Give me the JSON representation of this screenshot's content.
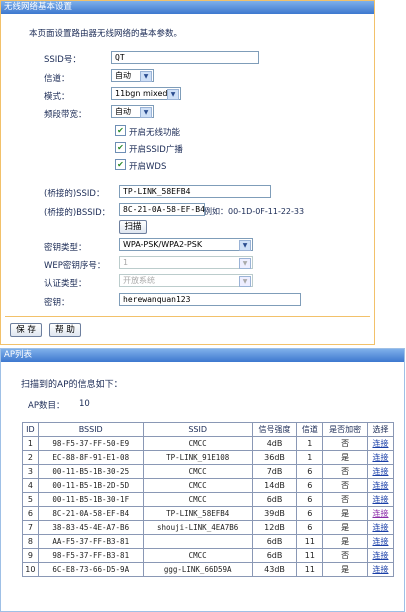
{
  "settings": {
    "title": "无线网络基本设置",
    "intro": "本页面设置路由器无线网络的基本参数。",
    "ssid_label": "SSID号：",
    "ssid_value": "QT",
    "channel_label": "信道：",
    "channel_value": "自动",
    "mode_label": "模式：",
    "mode_value": "11bgn mixed",
    "bandwidth_label": "频段带宽：",
    "bandwidth_value": "自动",
    "enable_wireless": "开启无线功能",
    "enable_ssid_broadcast": "开启SSID广播",
    "enable_wds": "开启WDS",
    "bridged_ssid_label": "(桥接的)SSID：",
    "bridged_ssid_value": "TP-LINK_58EFB4",
    "bridged_bssid_label": "(桥接的)BSSID：",
    "bridged_bssid_value": "8C-21-0A-58-EF-B4",
    "bssid_example": "例如：00-1D-0F-11-22-33",
    "scan_button": "扫描",
    "key_type_label": "密钥类型：",
    "key_type_value": "WPA-PSK/WPA2-PSK",
    "wep_index_label": "WEP密钥序号：",
    "wep_index_value": "1",
    "auth_type_label": "认证类型：",
    "auth_type_value": "开放系统",
    "key_label": "密钥：",
    "key_value": "herewanquan123",
    "save_button": "保 存",
    "help_button": "帮 助"
  },
  "ap_list": {
    "title": "AP列表",
    "heading": "扫描到的AP的信息如下：",
    "count_label": "AP数目：",
    "count_value": "10",
    "columns": [
      "ID",
      "BSSID",
      "SSID",
      "信号强度",
      "信道",
      "是否加密",
      "选择"
    ],
    "rows": [
      [
        "1",
        "98-F5-37-FF-50-E9",
        "CMCC",
        "4dB",
        "1",
        "否",
        "连接"
      ],
      [
        "2",
        "EC-88-8F-91-E1-08",
        "TP-LINK_91E108",
        "36dB",
        "1",
        "是",
        "连接"
      ],
      [
        "3",
        "00-11-B5-1B-30-25",
        "CMCC",
        "7dB",
        "6",
        "否",
        "连接"
      ],
      [
        "4",
        "00-11-B5-1B-2D-5D",
        "CMCC",
        "14dB",
        "6",
        "否",
        "连接"
      ],
      [
        "5",
        "00-11-B5-1B-30-1F",
        "CMCC",
        "6dB",
        "6",
        "否",
        "连接"
      ],
      [
        "6",
        "8C-21-0A-58-EF-B4",
        "TP-LINK_58EFB4",
        "39dB",
        "6",
        "是",
        "连接"
      ],
      [
        "7",
        "38-83-45-4E-A7-B6",
        "shouji-LINK_4EA7B6",
        "12dB",
        "6",
        "是",
        "连接"
      ],
      [
        "8",
        "AA-F5-37-FF-B3-81",
        "",
        "6dB",
        "11",
        "是",
        "连接"
      ],
      [
        "9",
        "98-F5-37-FF-B3-81",
        "CMCC",
        "6dB",
        "11",
        "否",
        "连接"
      ],
      [
        "10",
        "6C-E8-73-66-D5-9A",
        "ggg-LINK_66D59A",
        "43dB",
        "11",
        "是",
        "连接"
      ]
    ]
  }
}
